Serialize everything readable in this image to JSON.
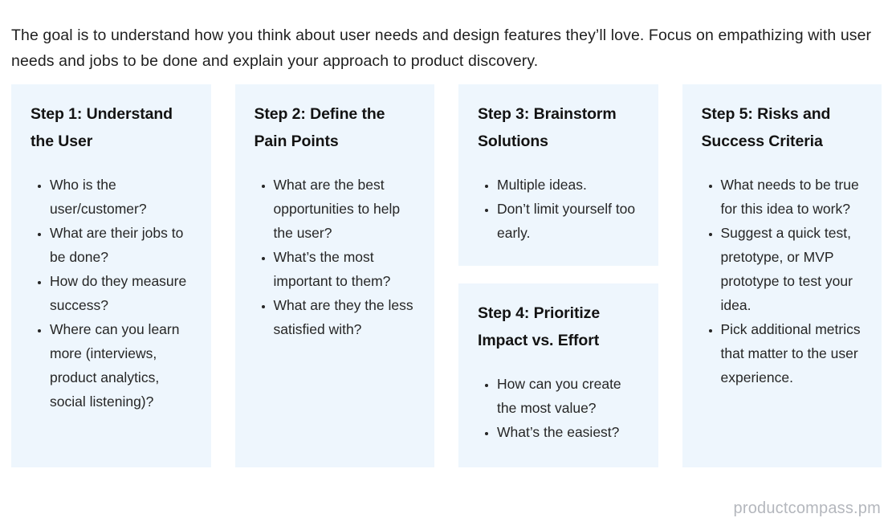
{
  "intro": {
    "text": "The goal is to understand how you think about user needs and design features they’ll love. Focus on empathizing with user needs and jobs to be done and explain your approach to product discovery."
  },
  "theme": {
    "card_background": "#eef6fd",
    "page_background": "#ffffff",
    "title_color": "#131313",
    "body_color": "#262626",
    "watermark_color": "#b4b7bd"
  },
  "columns": [
    {
      "cards": [
        {
          "title": "Step 1: Understand the User",
          "items": [
            "Who is the user/customer?",
            "What are their jobs to be done?",
            "How do they measure success?",
            "Where can you learn more (interviews, product analytics, social listening)?"
          ]
        }
      ]
    },
    {
      "cards": [
        {
          "title": "Step 2: Define the Pain Points",
          "items": [
            "What are the best opportunities to help the user?",
            "What’s the most important to them?",
            "What are they the less satisfied with?"
          ]
        }
      ]
    },
    {
      "cards": [
        {
          "title": "Step 3: Brainstorm Solutions",
          "items": [
            "Multiple ideas.",
            "Don’t limit yourself too early."
          ]
        },
        {
          "title": "Step 4: Prioritize Impact vs. Effort",
          "items": [
            "How can you create the most value?",
            "What’s the easiest?"
          ]
        }
      ]
    },
    {
      "cards": [
        {
          "title": "Step 5: Risks and Success Criteria",
          "items": [
            "What needs to be true for this idea to work?",
            "Suggest a quick test, pretotype, or MVP prototype to test your idea.",
            "Pick additional metrics that matter to the user experience."
          ]
        }
      ]
    }
  ],
  "watermark": {
    "text": "productcompass.pm"
  }
}
